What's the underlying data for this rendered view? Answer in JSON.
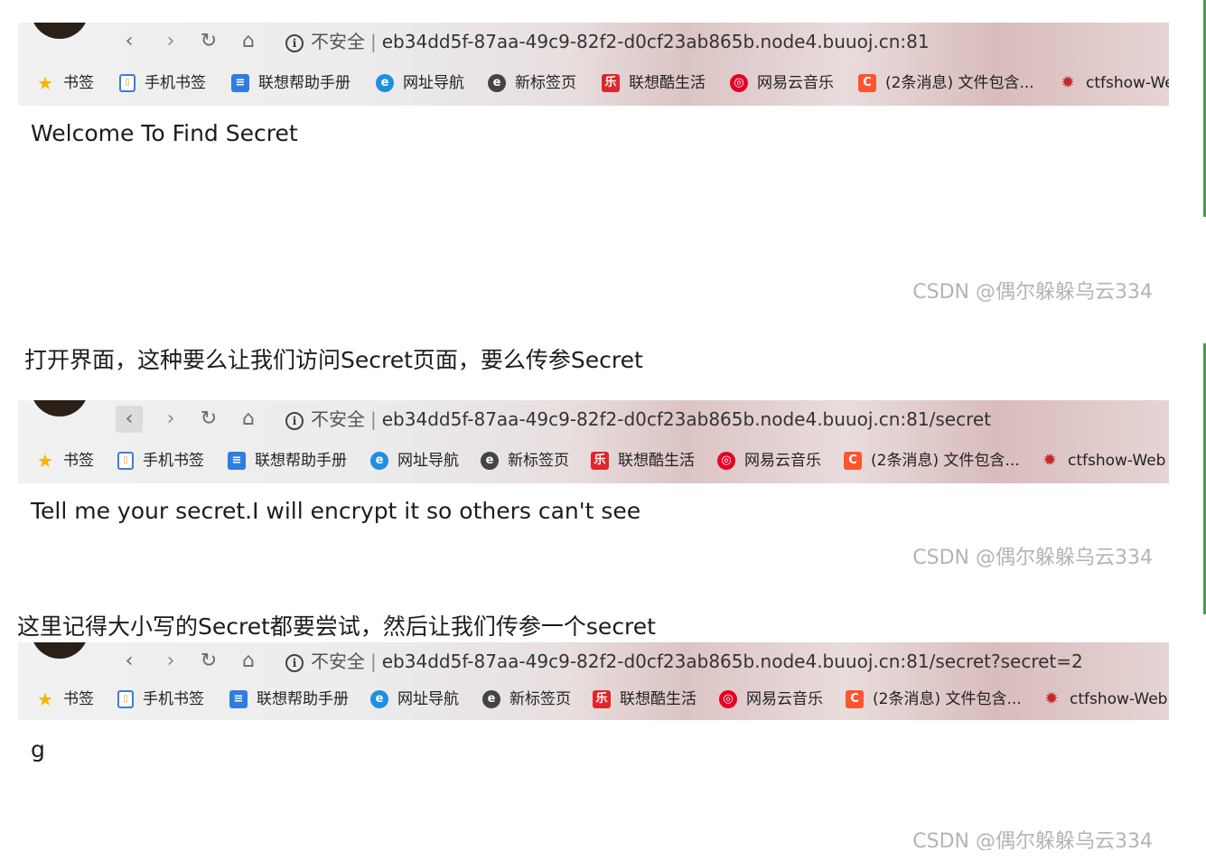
{
  "shots": [
    {
      "url": "eb34dd5f-87aa-49c9-82f2-d0cf23ab865b.node4.buuoj.cn:81",
      "page_text": "Welcome To Find Secret",
      "watermark": "CSDN @偶尔躲躲乌云334"
    },
    {
      "url": "eb34dd5f-87aa-49c9-82f2-d0cf23ab865b.node4.buuoj.cn:81/secret",
      "page_text": "Tell me your secret.I will encrypt it so others can't see",
      "watermark": "CSDN @偶尔躲躲乌云334"
    },
    {
      "url": "eb34dd5f-87aa-49c9-82f2-d0cf23ab865b.node4.buuoj.cn:81/secret?secret=2",
      "page_text": "g",
      "watermark": "CSDN @偶尔躲躲乌云334"
    }
  ],
  "browser": {
    "insecure_label": "不安全",
    "separator": "|",
    "bookmarks": {
      "b1": {
        "label": "书签",
        "icon": "star-icon"
      },
      "b2": {
        "label": "手机书签",
        "icon": "phone-bookmark-icon"
      },
      "b3": {
        "label": "联想帮助手册",
        "icon": "document-icon"
      },
      "b4": {
        "label": "网址导航",
        "icon": "edge-icon"
      },
      "b5": {
        "label": "新标签页",
        "icon": "e-icon"
      },
      "b6": {
        "label": "联想酷生活",
        "icon": "lenovo-icon"
      },
      "b7": {
        "label": "网易云音乐",
        "icon": "netease-music-icon"
      },
      "b8": {
        "label": "(2条消息) 文件包含...",
        "icon": "csdn-icon"
      },
      "b9": {
        "label": "ctfshow-Web",
        "icon": "spider-icon"
      }
    },
    "icon_glyphs": {
      "back": "‹",
      "forward": "›",
      "reload": "↻",
      "home": "⌂",
      "info": "i",
      "star": "★",
      "phone": "▯",
      "doc": "≡",
      "edge": "e",
      "e": "e",
      "lenovo": "乐",
      "music": "◎",
      "c": "C",
      "spider": "✹"
    }
  },
  "captions": {
    "c1": "打开界面，这种要么让我们访问Secret页面，要么传参Secret",
    "c2": "这里记得大小写的Secret都要尝试，然后让我们传参一个secret"
  },
  "colors": {
    "watermark": "#b4b4b4",
    "accent_bar": "#4c9a4c"
  }
}
